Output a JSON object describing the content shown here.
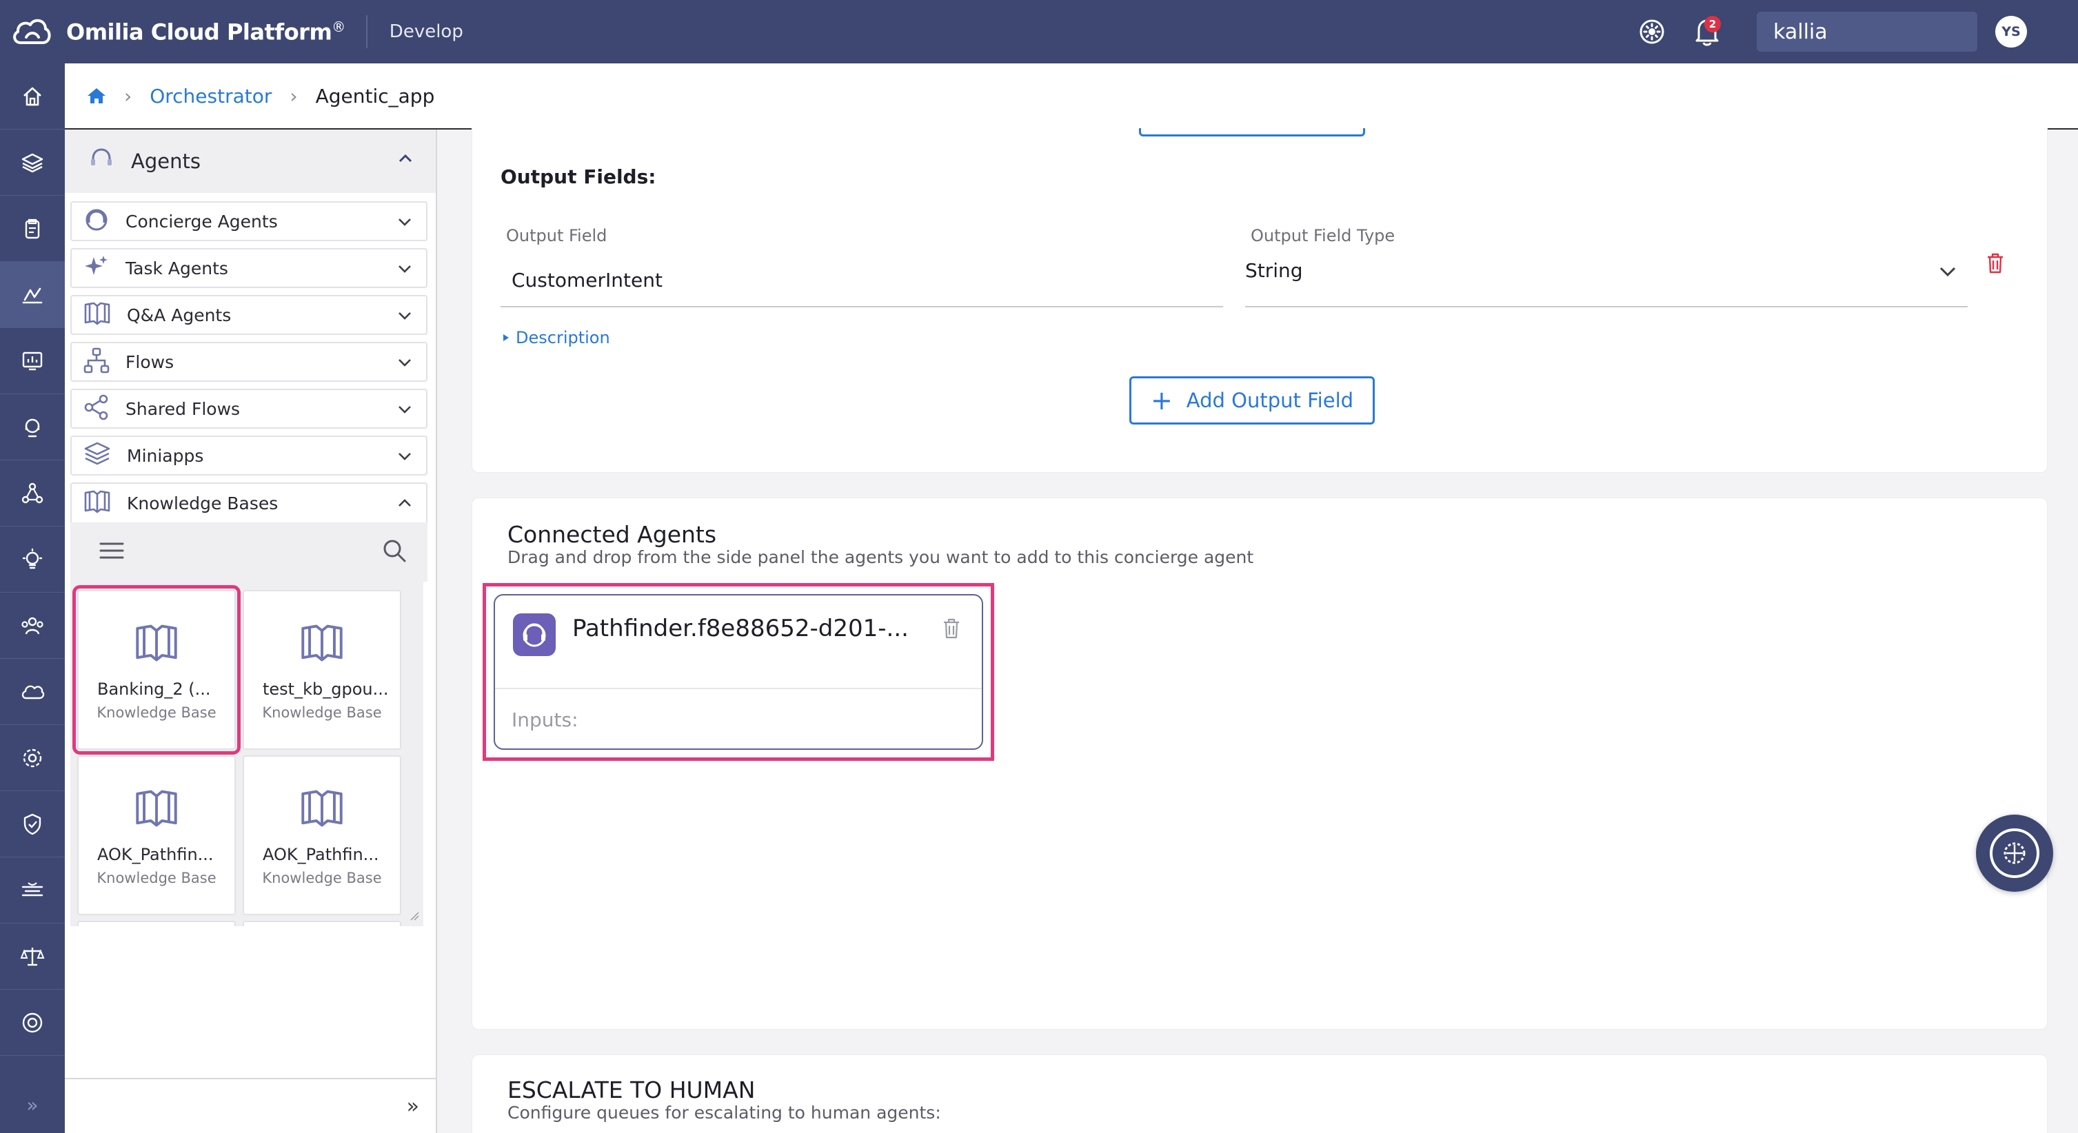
{
  "topbar": {
    "brand": "Omilia Cloud Platform",
    "brand_mark": "®",
    "mode": "Develop",
    "notifications_count": "2",
    "username": "kallia",
    "avatar_initials": "YS"
  },
  "rail": {
    "items": [
      "home-icon",
      "layers-icon",
      "clipboard-icon",
      "orchestrator-icon",
      "dashboard-icon",
      "support-icon",
      "network-icon",
      "insights-icon",
      "team-icon",
      "cloud-icon",
      "settings-icon",
      "security-icon",
      "speech-icon",
      "legal-icon",
      "help-icon"
    ],
    "active_index": 3
  },
  "breadcrumb": {
    "parent": "Orchestrator",
    "current": "Agentic_app"
  },
  "side_panel": {
    "title": "Agents",
    "categories": [
      {
        "label": "Concierge Agents",
        "icon": "headset-icon",
        "expanded": false
      },
      {
        "label": "Task Agents",
        "icon": "sparkle-icon",
        "expanded": false
      },
      {
        "label": "Q&A Agents",
        "icon": "book-icon",
        "expanded": false
      },
      {
        "label": "Flows",
        "icon": "flow-icon",
        "expanded": false
      },
      {
        "label": "Shared Flows",
        "icon": "share-icon",
        "expanded": false
      },
      {
        "label": "Miniapps",
        "icon": "layers-icon",
        "expanded": false
      },
      {
        "label": "Knowledge Bases",
        "icon": "book-icon",
        "expanded": true
      }
    ],
    "knowledge_bases": [
      {
        "name": "Banking_2 (...",
        "type": "Knowledge Base",
        "selected": true
      },
      {
        "name": "test_kb_gpou...",
        "type": "Knowledge Base",
        "selected": false
      },
      {
        "name": "AOK_Pathfin...",
        "type": "Knowledge Base",
        "selected": false
      },
      {
        "name": "AOK_Pathfin...",
        "type": "Knowledge Base",
        "selected": false
      }
    ]
  },
  "output_fields": {
    "heading": "Output Fields:",
    "field_label": "Output Field",
    "field_value": "CustomerIntent",
    "type_label": "Output Field Type",
    "type_value": "String",
    "description_link": "Description",
    "add_button": "Add Output Field"
  },
  "connected_agents": {
    "title": "Connected Agents",
    "subtitle": "Drag and drop from the side panel the agents you want to add to this concierge agent",
    "agent": {
      "name": "Pathfinder.f8e88652-d201-...",
      "inputs_label": "Inputs:"
    }
  },
  "escalate": {
    "title": "ESCALATE TO HUMAN",
    "subtitle": "Configure queues for escalating to human agents:"
  },
  "colors": {
    "topbar": "#3d4772",
    "accent": "#2979d6",
    "highlight": "#e03a7c",
    "danger": "#e03043"
  }
}
